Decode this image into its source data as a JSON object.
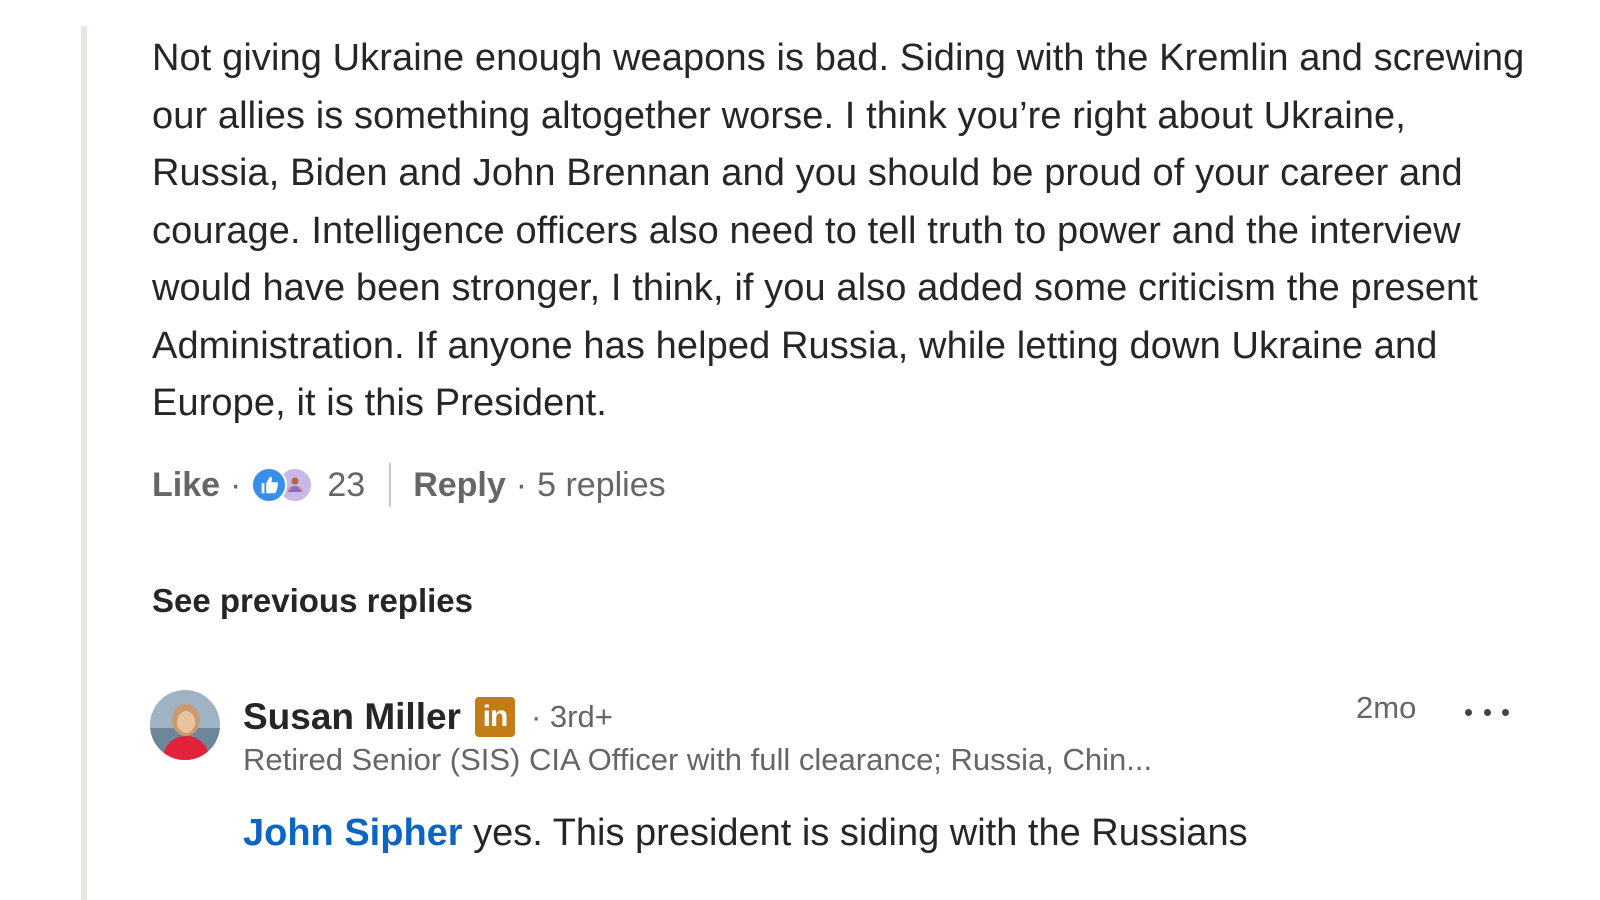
{
  "comment": {
    "text": "Not giving Ukraine enough weapons is bad. Siding with the Kremlin and screwing our allies is something altogether worse. I think you’re right about Ukraine, Russia, Biden and John Brennan and you should be proud of your career and courage. Intelligence officers also need to tell truth to power and the interview would have been stronger, I think, if you also added some criticism the present Administration. If anyone has helped Russia, while letting down Ukraine and Europe, it is this President.",
    "like_label": "Like",
    "separator": "·",
    "reaction_icons": [
      "like-icon",
      "support-icon"
    ],
    "reaction_count": "23",
    "reply_label": "Reply",
    "replies_count": "5 replies"
  },
  "thread": {
    "see_previous_label": "See previous replies"
  },
  "reply": {
    "author_name": "Susan Miller",
    "badge_text": "in",
    "degree": "· 3rd+",
    "headline": "Retired Senior (SIS) CIA Officer with full clearance; Russia, Chin...",
    "time": "2mo",
    "mention": "John Sipher",
    "text": " yes. This president is siding with the Russians"
  },
  "colors": {
    "mention_blue": "#0a66c2",
    "like_blue": "#378fe9",
    "premium_gold": "#c37d16",
    "thread_line": "#e9e5df"
  }
}
